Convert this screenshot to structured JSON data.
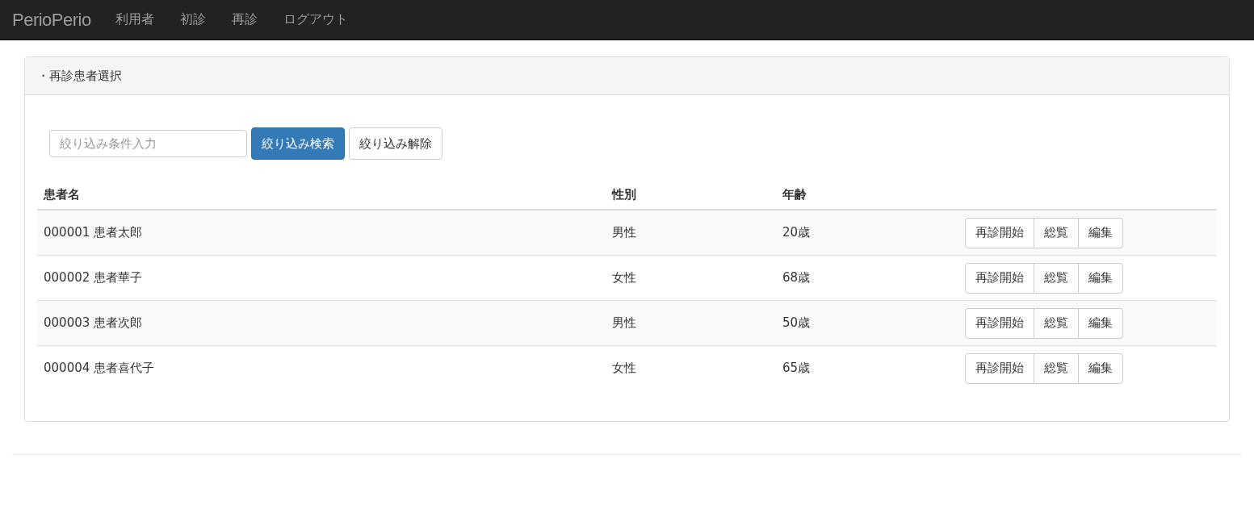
{
  "navbar": {
    "brand": "PerioPerio",
    "items": [
      "利用者",
      "初診",
      "再診",
      "ログアウト"
    ]
  },
  "panel": {
    "title": "・再診患者選択",
    "filter": {
      "placeholder": "絞り込み条件入力",
      "buttons": [
        {
          "label": "絞り込み検索",
          "kind": "primary"
        },
        {
          "label": "絞り込み解除",
          "kind": "default"
        }
      ]
    },
    "table": {
      "columns": [
        "患者名",
        "性別",
        "年齢"
      ],
      "rows": [
        {
          "name": "000001 患者太郎",
          "sex": "男性",
          "age": "20歳",
          "actions": [
            "再診開始",
            "総覧",
            "編集"
          ]
        },
        {
          "name": "000002 患者華子",
          "sex": "女性",
          "age": "68歳",
          "actions": [
            "再診開始",
            "総覧",
            "編集"
          ]
        },
        {
          "name": "000003 患者次郎",
          "sex": "男性",
          "age": "50歳",
          "actions": [
            "再診開始",
            "総覧",
            "編集"
          ]
        },
        {
          "name": "000004 患者喜代子",
          "sex": "女性",
          "age": "65歳",
          "actions": [
            "再診開始",
            "総覧",
            "編集"
          ]
        }
      ]
    }
  }
}
